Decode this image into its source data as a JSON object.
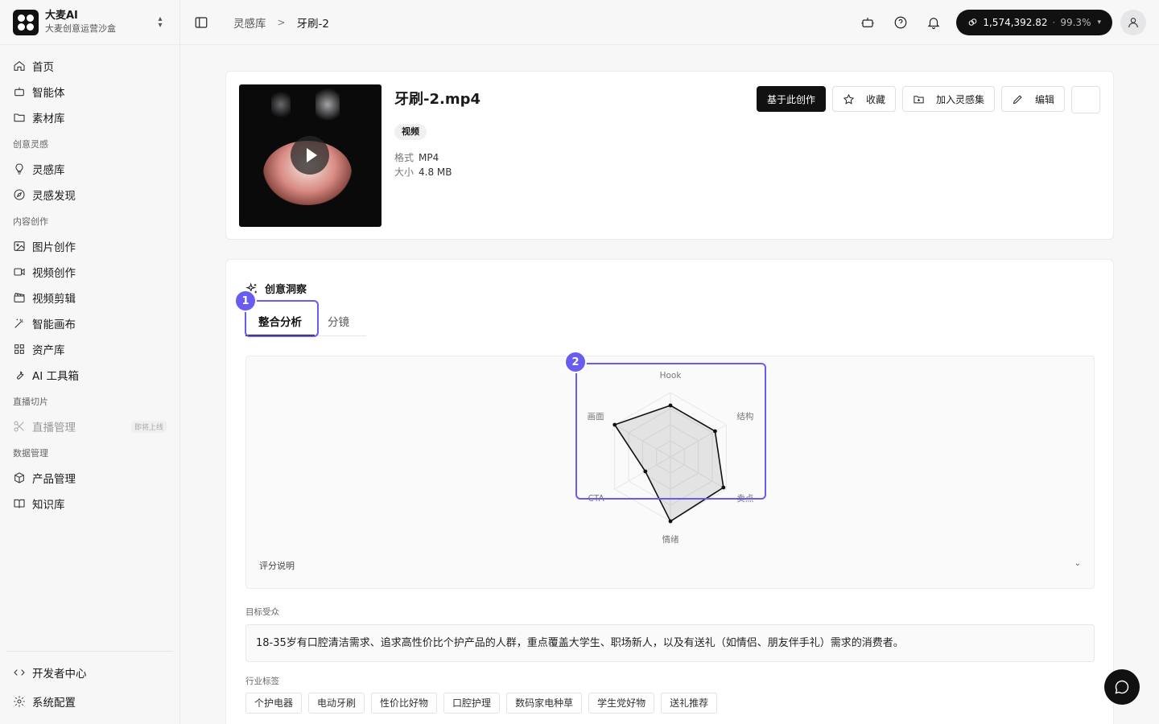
{
  "brand": {
    "name": "大麦AI",
    "subtitle": "大麦创意运营沙盒"
  },
  "nav": {
    "home": "首页",
    "agent": "智能体",
    "assets_lib": "素材库",
    "group_inspiration": "创意灵感",
    "inspiration_lib": "灵感库",
    "inspiration_discover": "灵感发现",
    "group_content": "内容创作",
    "image_create": "图片创作",
    "video_create": "视频创作",
    "video_edit": "视频剪辑",
    "canvas": "智能画布",
    "asset_store": "资产库",
    "ai_tools": "AI 工具箱",
    "group_live": "直播切片",
    "live_manage": "直播管理",
    "coming_soon": "即将上线",
    "group_data": "数据管理",
    "product_manage": "产品管理",
    "knowledge": "知识库",
    "developer": "开发者中心",
    "settings": "系统配置"
  },
  "breadcrumb": {
    "parent": "灵感库",
    "current": "牙刷-2"
  },
  "balance": {
    "amount": "1,574,392.82",
    "percent": "99.3%"
  },
  "file": {
    "title": "牙刷-2.mp4",
    "type_tag": "视频",
    "format_label": "格式",
    "format_value": "MP4",
    "size_label": "大小",
    "size_value": "4.8 MB"
  },
  "actions": {
    "create_from": "基于此创作",
    "favorite": "收藏",
    "add_to_collection": "加入灵感集",
    "edit": "编辑"
  },
  "insight": {
    "title": "创意洞察",
    "tabs": [
      "整合分析",
      "分镜"
    ],
    "score_note": "评分说明",
    "audience_label": "目标受众",
    "audience_text": "18-35岁有口腔清洁需求、追求高性价比个护产品的人群，重点覆盖大学生、职场新人，以及有送礼（如情侣、朋友伴手礼）需求的消费者。",
    "industry_label": "行业标签",
    "industry_tags": [
      "个护电器",
      "电动牙刷",
      "性价比好物",
      "口腔护理",
      "数码家电种草",
      "学生党好物",
      "送礼推荐"
    ]
  },
  "badges": [
    "1",
    "2"
  ],
  "chart_data": {
    "type": "radar",
    "axes": [
      "Hook",
      "结构",
      "卖点",
      "情绪",
      "CTA",
      "画面"
    ],
    "values": [
      0.8,
      0.8,
      0.95,
      1.0,
      0.45,
      1.0
    ],
    "range": [
      0,
      1
    ]
  },
  "colors": {
    "accent": "#6a5cf0",
    "primary": "#111111"
  }
}
